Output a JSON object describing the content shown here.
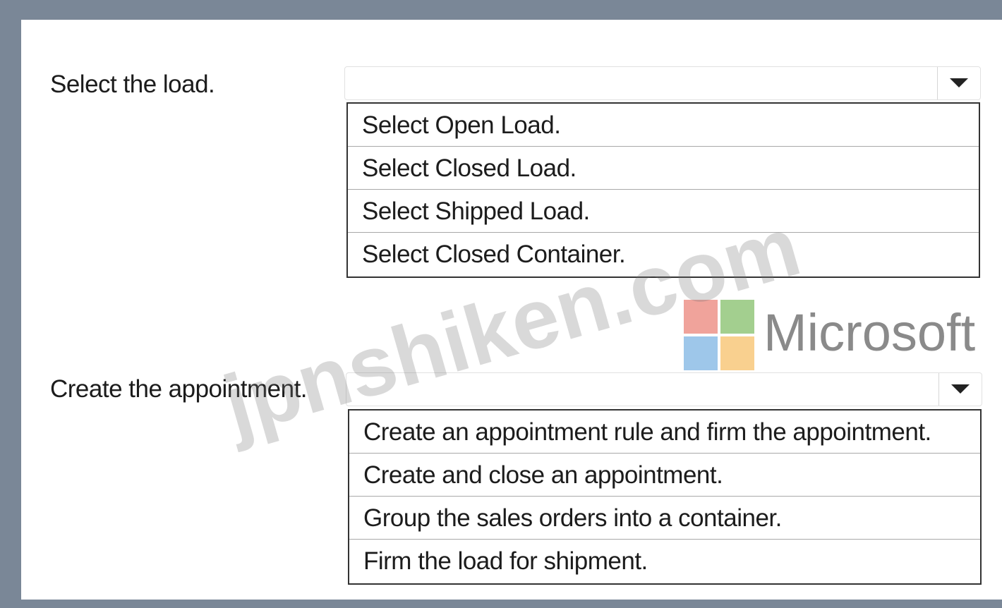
{
  "question_1": {
    "label": "Select the load.",
    "selected": "",
    "options": [
      "Select Open Load.",
      "Select Closed Load.",
      "Select Shipped Load.",
      "Select Closed Container."
    ]
  },
  "question_2": {
    "label": "Create the appointment.",
    "selected": "",
    "options": [
      "Create an appointment rule and firm the appointment.",
      "Create and close an appointment.",
      "Group the sales orders into a container.",
      "Firm the load for shipment."
    ]
  },
  "branding": {
    "logo_text": "Microsoft",
    "logo_colors": [
      "#f0a39b",
      "#a3cf8f",
      "#9ec7ea",
      "#f9d08f"
    ],
    "watermark": "jpnshiken.com"
  }
}
